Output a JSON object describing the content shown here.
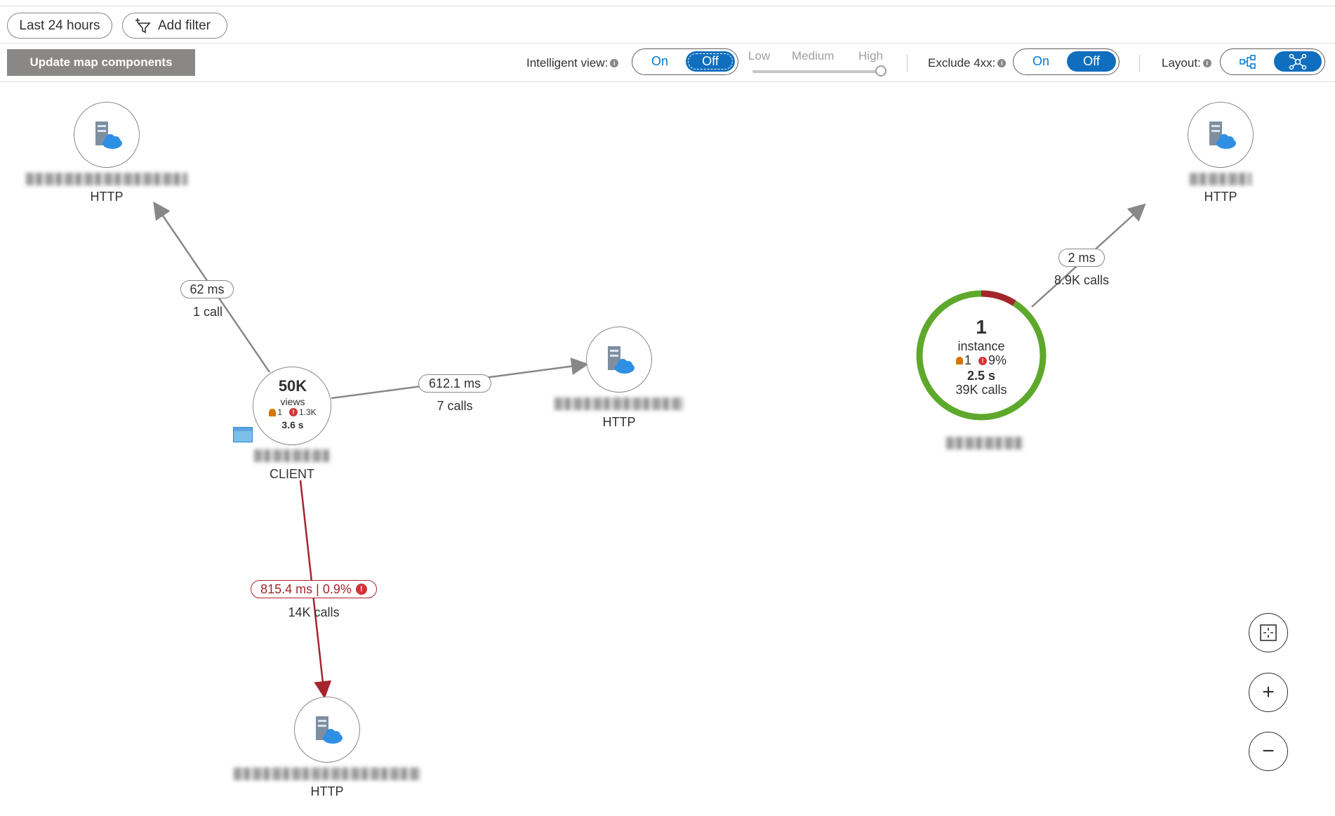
{
  "filters": {
    "time_range": "Last 24 hours",
    "add_filter": "Add filter"
  },
  "toolbar": {
    "update_button": "Update map components",
    "intelligent_view_label": "Intelligent view:",
    "intelligent_view_on": "On",
    "intelligent_view_off": "Off",
    "sensitivity_low": "Low",
    "sensitivity_medium": "Medium",
    "sensitivity_high": "High",
    "exclude_label": "Exclude 4xx:",
    "exclude_on": "On",
    "exclude_off": "Off",
    "layout_label": "Layout:"
  },
  "nodes": {
    "http_top_left": {
      "type": "HTTP"
    },
    "http_middle": {
      "type": "HTTP"
    },
    "http_bottom": {
      "type": "HTTP"
    },
    "http_top_right": {
      "type": "HTTP"
    },
    "client": {
      "value": "50K",
      "unit": "views",
      "alerts": "1",
      "errors": "1.3K",
      "duration": "3.6 s",
      "type": "CLIENT"
    },
    "instance": {
      "value": "1",
      "unit": "instance",
      "alerts": "1",
      "errors": "9%",
      "duration": "2.5 s",
      "calls": "39K calls",
      "failure_fraction": 0.09
    }
  },
  "edges": {
    "client_to_top_left": {
      "duration": "62 ms",
      "calls": "1 call"
    },
    "client_to_middle": {
      "duration": "612.1 ms",
      "calls": "7 calls"
    },
    "client_to_bottom": {
      "duration": "815.4 ms | 0.9%",
      "calls": "14K calls"
    },
    "instance_to_top_right": {
      "duration": "2 ms",
      "calls": "8.9K calls"
    }
  },
  "map_controls": {
    "zoom_in": "+",
    "zoom_out": "−"
  },
  "colors": {
    "accent": "#106ebe",
    "error": "#a4262c",
    "healthy": "#5ea82b",
    "edge": "#8a8886"
  }
}
